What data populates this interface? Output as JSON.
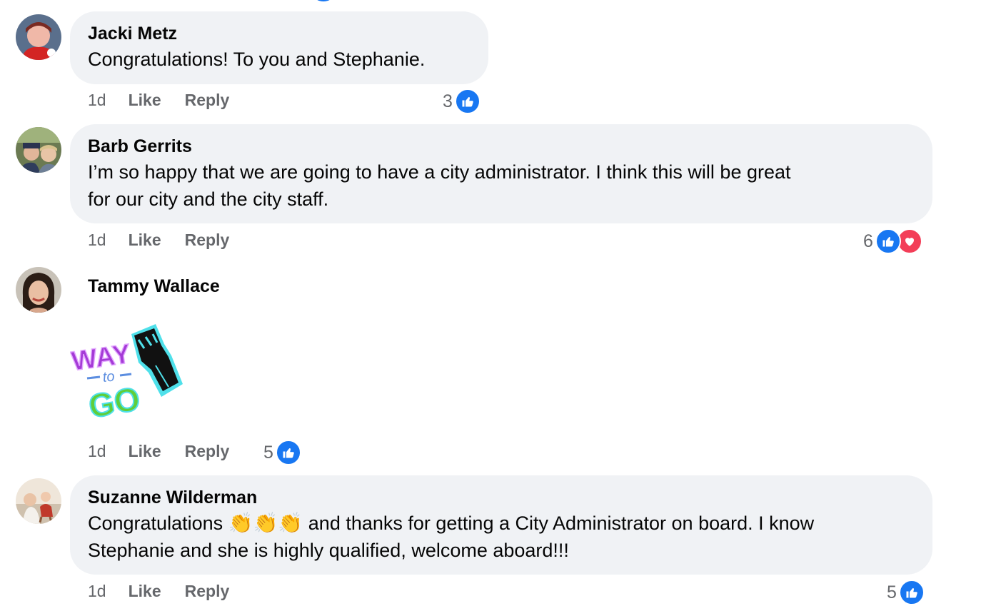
{
  "colors": {
    "like_blue": "#1877f2",
    "love_red": "#f33e58",
    "bubble_bg": "#f0f2f5",
    "meta_gray": "#65676b"
  },
  "comments": [
    {
      "author": "Jacki Metz",
      "text": "Congratulations! To you and Stephanie.",
      "time": "1d",
      "like_label": "Like",
      "reply_label": "Reply",
      "reaction_count": "3",
      "reactions": [
        "like-icon"
      ]
    },
    {
      "author": "Barb Gerrits",
      "text_line1": "I’m so happy that we are going to have a city administrator. I think this will be great",
      "text_line2": "for our city and the city staff.",
      "time": "1d",
      "like_label": "Like",
      "reply_label": "Reply",
      "reaction_count": "6",
      "reactions": [
        "like-icon",
        "love-icon"
      ]
    },
    {
      "author": "Tammy Wallace",
      "sticker": {
        "word1": "WAY",
        "word2": "to",
        "word3": "GO",
        "icon": "raised-fist-icon"
      },
      "time": "1d",
      "like_label": "Like",
      "reply_label": "Reply",
      "reaction_count": "5",
      "reactions": [
        "like-icon"
      ]
    },
    {
      "author": "Suzanne Wilderman",
      "text_line1_a": "Congratulations",
      "emoji": "👏",
      "text_line1_b": "and thanks for getting a City Administrator on board. I know",
      "text_line2": "Stephanie and she is highly qualified, welcome aboard!!!",
      "time": "1d",
      "like_label": "Like",
      "reply_label": "Reply",
      "reaction_count": "5",
      "reactions": [
        "like-icon"
      ]
    }
  ]
}
